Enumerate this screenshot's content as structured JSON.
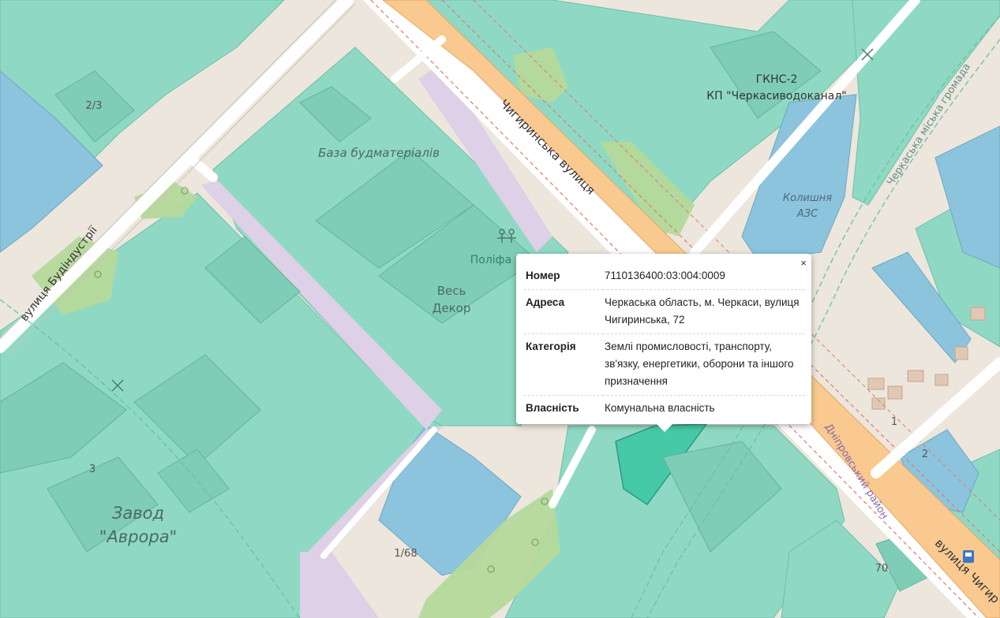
{
  "map": {
    "street_labels": {
      "chyhyrynska_main": "Чигиринська вулиця",
      "chyhyrynska_bottom": "вулиця Чигир",
      "budindustrii": "вулиця Будіндустрії",
      "cherkaska_hromada": "Черкаська міська громада",
      "dniprovskyi_raion": "Дніпровський район"
    },
    "place_labels": {
      "gkns_line1": "ГКНС-2",
      "gkns_line2": "КП \"Черкасиводоканал\"",
      "baza": "База будматеріалів",
      "polifa": "Поліфа",
      "ves_line1": "Весь",
      "ves_line2": "Декор",
      "azs_line1": "Колишня",
      "azs_line2": "АЗС",
      "zavod_line1": "Завод",
      "zavod_line2": "\"Аврора\""
    },
    "house_numbers": {
      "n2_3": "2/3",
      "n3": "3",
      "n1_68": "1/68",
      "n70": "70",
      "n1": "1",
      "n2": "2"
    }
  },
  "popup": {
    "close_label": "×",
    "rows": [
      {
        "key": "Номер",
        "value": "7110136400:03:004:0009"
      },
      {
        "key": "Адреса",
        "value": "Черкаська область, м. Черкаси, вулиця Чигиринська, 72"
      },
      {
        "key": "Категорія",
        "value": "Землі промисловості, транспорту, зв'язку, енергетики, оборони та іншого призначення"
      },
      {
        "key": "Власність",
        "value": "Комунальна власність"
      }
    ]
  },
  "colors": {
    "parcel_teal": "#8fd9c4",
    "parcel_dark_teal": "#45c9a6",
    "parcel_blue": "#8cc4dd",
    "road_orange": "#f9c98f",
    "park_green": "#b5d99a",
    "industrial_pink": "#ded0e6",
    "street_white": "#ffffff"
  }
}
